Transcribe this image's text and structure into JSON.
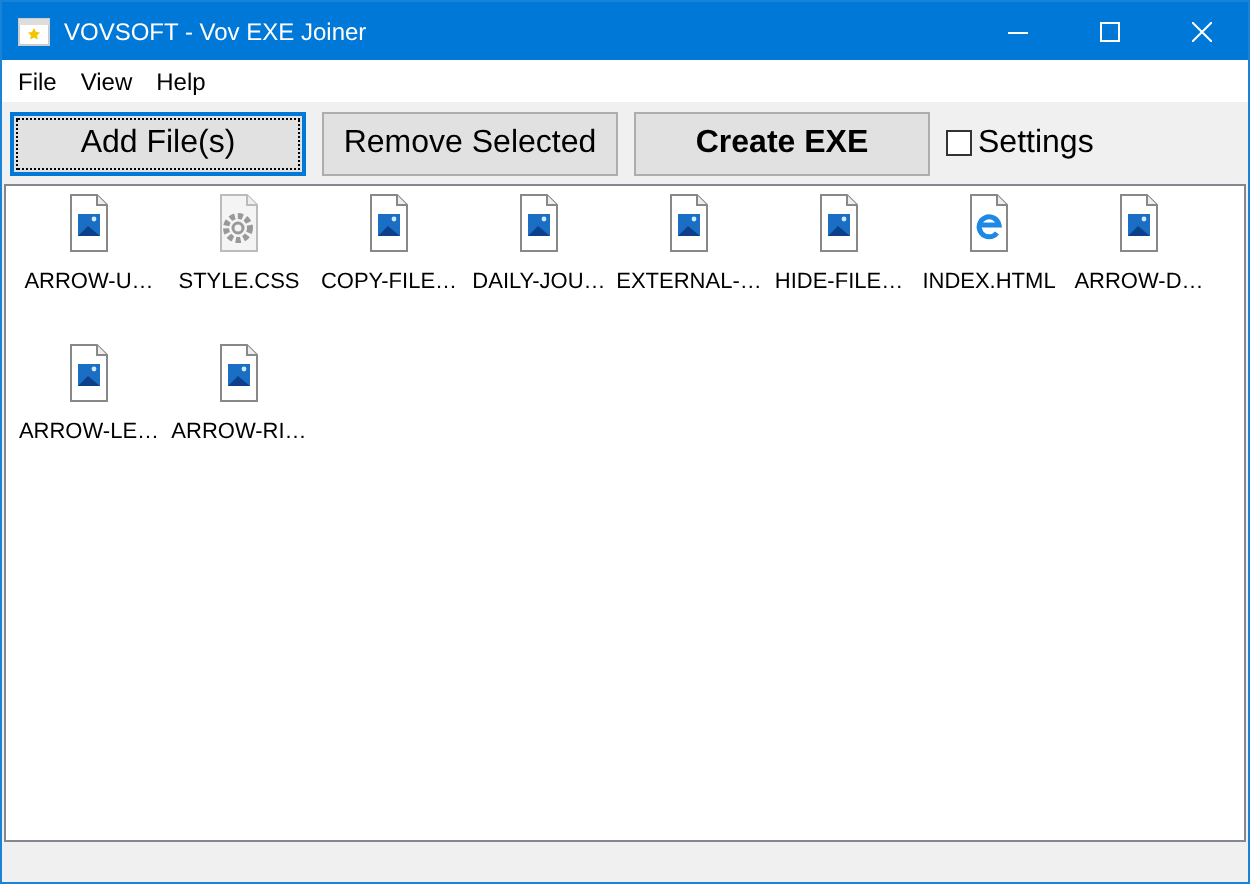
{
  "window": {
    "title": "VOVSOFT - Vov EXE Joiner"
  },
  "menu": [
    "File",
    "View",
    "Help"
  ],
  "toolbar": {
    "buttons": [
      {
        "label": "Add File(s)",
        "focused": true,
        "bold": false
      },
      {
        "label": "Remove Selected",
        "focused": false,
        "bold": false
      },
      {
        "label": "Create EXE",
        "focused": false,
        "bold": true
      }
    ],
    "settings": {
      "label": "Settings",
      "checked": false
    }
  },
  "files": [
    {
      "name": "ARROW-U…",
      "kind": "image"
    },
    {
      "name": "STYLE.CSS",
      "kind": "css"
    },
    {
      "name": "COPY-FILE…",
      "kind": "image"
    },
    {
      "name": "DAILY-JOU…",
      "kind": "image"
    },
    {
      "name": "EXTERNAL-…",
      "kind": "image"
    },
    {
      "name": "HIDE-FILE…",
      "kind": "image"
    },
    {
      "name": "INDEX.HTML",
      "kind": "html"
    },
    {
      "name": "ARROW-D…",
      "kind": "image"
    },
    {
      "name": "ARROW-LE…",
      "kind": "image"
    },
    {
      "name": "ARROW-RI…",
      "kind": "image"
    }
  ]
}
